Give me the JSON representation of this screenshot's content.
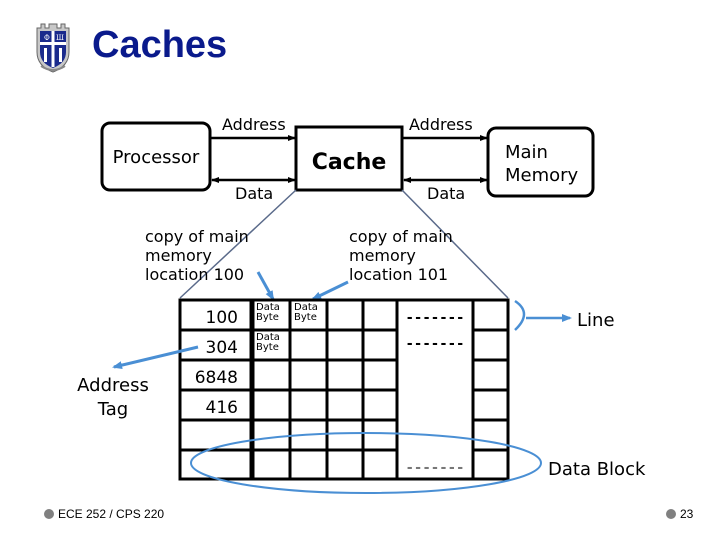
{
  "slide": {
    "title": "Caches",
    "footer_left": "ECE 252 / CPS 220",
    "page_number": "23",
    "logo": "university-shield-logo"
  },
  "diagram": {
    "processor_label": "Processor",
    "cache_label": "Cache",
    "main_memory_label_line1": "Main",
    "main_memory_label_line2": "Memory",
    "address_label_left": "Address",
    "address_label_right": "Address",
    "data_label_left": "Data",
    "data_label_right": "Data",
    "copy_100": [
      "copy of main",
      "memory",
      "location 100"
    ],
    "copy_101": [
      "copy of main",
      "memory",
      "location 101"
    ],
    "address_tag_line1": "Address",
    "address_tag_line2": "Tag",
    "line_label": "Line",
    "data_block_label": "Data Block",
    "tags": [
      "100",
      "304",
      "6848",
      "416",
      "",
      ""
    ],
    "data_byte_text": [
      "Data",
      "Byte"
    ],
    "data_byte_cells": [
      {
        "row": 0,
        "col": 0
      },
      {
        "row": 0,
        "col": 1
      },
      {
        "row": 1,
        "col": 0
      }
    ],
    "ellipsis": "-------",
    "accent_color": "#4a8fd4"
  }
}
